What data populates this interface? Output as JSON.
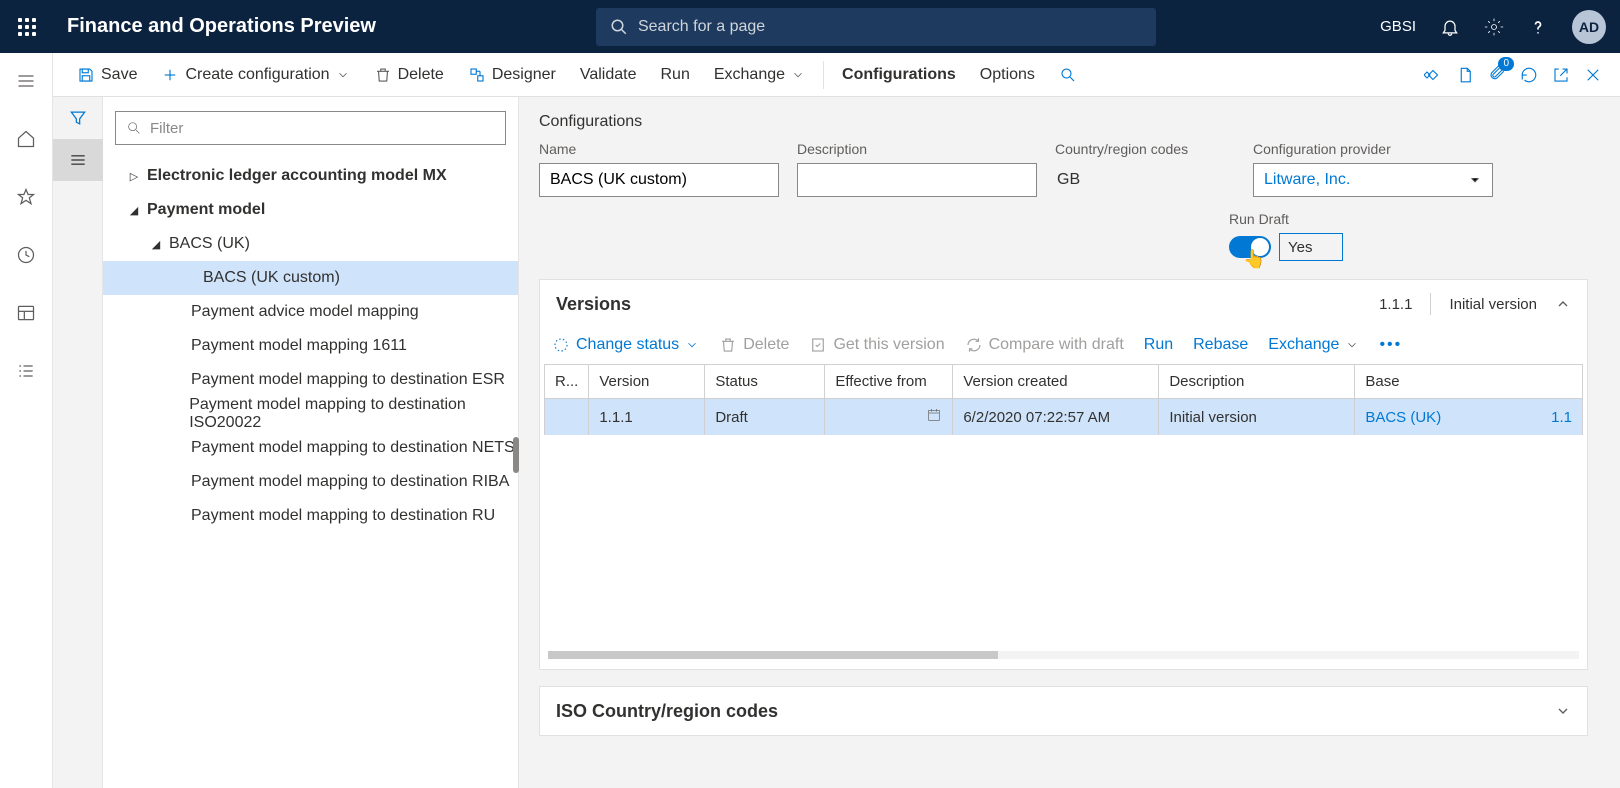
{
  "topnav": {
    "brand": "Finance and Operations Preview",
    "search_placeholder": "Search for a page",
    "company": "GBSI",
    "avatar": "AD"
  },
  "actionbar": {
    "save": "Save",
    "create_config": "Create configuration",
    "delete": "Delete",
    "designer": "Designer",
    "validate": "Validate",
    "run": "Run",
    "exchange": "Exchange",
    "configurations": "Configurations",
    "options": "Options",
    "badge": "0"
  },
  "tree": {
    "filter_placeholder": "Filter",
    "items": [
      {
        "label": "Electronic ledger accounting model MX",
        "level": 0,
        "caret": "▷",
        "bold": true
      },
      {
        "label": "Payment model",
        "level": 0,
        "caret": "◢",
        "bold": true
      },
      {
        "label": "BACS (UK)",
        "level": 1,
        "caret": "◢",
        "bold": false
      },
      {
        "label": "BACS (UK custom)",
        "level": 2,
        "caret": "",
        "bold": false,
        "selected": true
      },
      {
        "label": "Payment advice model mapping",
        "level": 1,
        "caret": "",
        "bold": false,
        "leaf": true
      },
      {
        "label": "Payment model mapping 1611",
        "level": 1,
        "caret": "",
        "bold": false,
        "leaf": true
      },
      {
        "label": "Payment model mapping to destination ESR",
        "level": 1,
        "caret": "",
        "bold": false,
        "leaf": true
      },
      {
        "label": "Payment model mapping to destination ISO20022",
        "level": 1,
        "caret": "",
        "bold": false,
        "leaf": true
      },
      {
        "label": "Payment model mapping to destination NETS",
        "level": 1,
        "caret": "",
        "bold": false,
        "leaf": true
      },
      {
        "label": "Payment model mapping to destination RIBA",
        "level": 1,
        "caret": "",
        "bold": false,
        "leaf": true
      },
      {
        "label": "Payment model mapping to destination RU",
        "level": 1,
        "caret": "",
        "bold": false,
        "leaf": true
      }
    ]
  },
  "config": {
    "section": "Configurations",
    "name_label": "Name",
    "name_value": "BACS (UK custom)",
    "desc_label": "Description",
    "desc_value": "",
    "cc_label": "Country/region codes",
    "cc_value": "GB",
    "prov_label": "Configuration provider",
    "prov_value": "Litware, Inc.",
    "run_draft_label": "Run Draft",
    "run_draft_value": "Yes"
  },
  "versions": {
    "title": "Versions",
    "summary_version": "1.1.1",
    "summary_desc": "Initial version",
    "toolbar": {
      "change_status": "Change status",
      "delete": "Delete",
      "get": "Get this version",
      "compare": "Compare with draft",
      "run": "Run",
      "rebase": "Rebase",
      "exchange": "Exchange"
    },
    "columns": {
      "r": "R...",
      "version": "Version",
      "status": "Status",
      "effective": "Effective from",
      "created": "Version created",
      "desc": "Description",
      "base": "Base"
    },
    "rows": [
      {
        "version": "1.1.1",
        "status": "Draft",
        "effective": "",
        "created": "6/2/2020 07:22:57 AM",
        "desc": "Initial version",
        "base_name": "BACS (UK)",
        "base_ver": "1.1"
      }
    ]
  },
  "iso_card": {
    "title": "ISO Country/region codes"
  }
}
